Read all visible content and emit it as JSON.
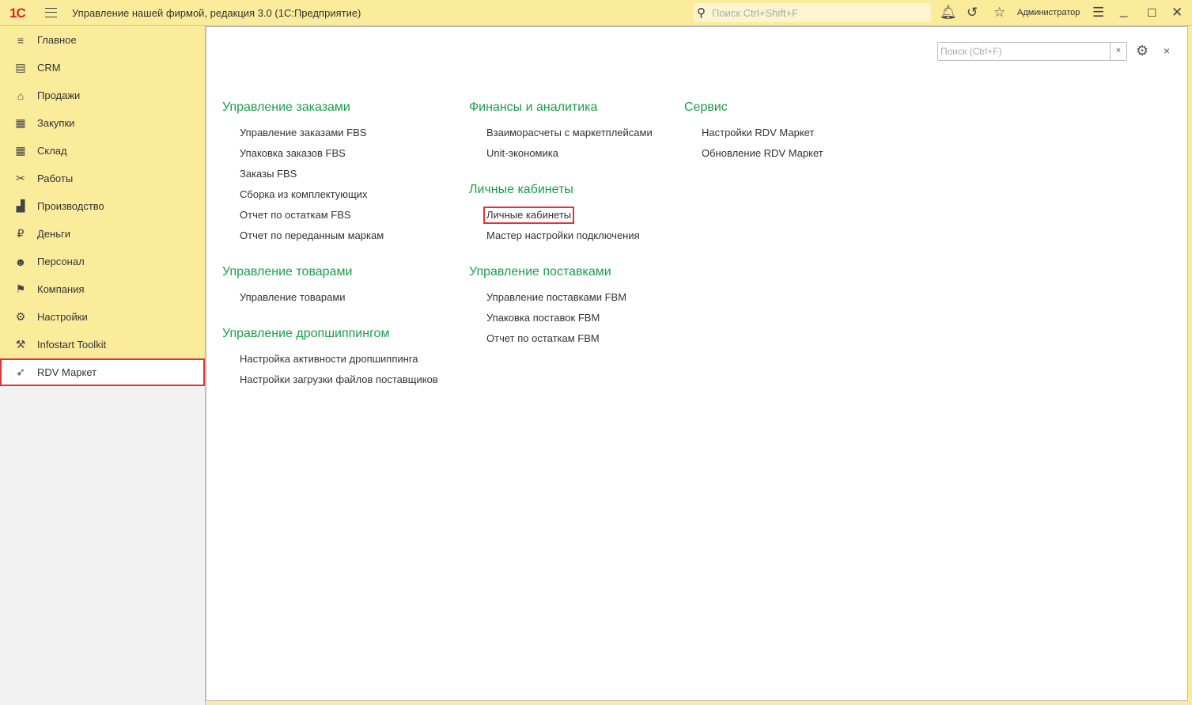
{
  "titlebar": {
    "logo": "1С",
    "title": "Управление нашей фирмой, редакция 3.0  (1С:Предприятие)",
    "search_placeholder": "Поиск Ctrl+Shift+F",
    "user": "Администратор"
  },
  "sidebar": {
    "items": [
      {
        "label": "Главное",
        "icon": "≡"
      },
      {
        "label": "CRM",
        "icon": "▤"
      },
      {
        "label": "Продажи",
        "icon": "⌂"
      },
      {
        "label": "Закупки",
        "icon": "▦"
      },
      {
        "label": "Склад",
        "icon": "▦"
      },
      {
        "label": "Работы",
        "icon": "✂"
      },
      {
        "label": "Производство",
        "icon": "▟"
      },
      {
        "label": "Деньги",
        "icon": "₽"
      },
      {
        "label": "Персонал",
        "icon": "☻"
      },
      {
        "label": "Компания",
        "icon": "⚑"
      },
      {
        "label": "Настройки",
        "icon": "⚙"
      },
      {
        "label": "Infostart Toolkit",
        "icon": "⚒"
      },
      {
        "label": "RDV Маркет",
        "icon": "➶"
      }
    ],
    "selected": "RDV Маркет"
  },
  "panel": {
    "search_placeholder": "Поиск (Ctrl+F)",
    "clear": "×",
    "close": "×"
  },
  "columns": [
    [
      {
        "title": "Управление заказами",
        "links": [
          "Управление заказами FBS",
          "Упаковка заказов FBS",
          "Заказы FBS",
          "Сборка из комплектующих",
          "Отчет по остаткам FBS",
          "Отчет по переданным маркам"
        ]
      },
      {
        "title": "Управление товарами",
        "links": [
          "Управление товарами"
        ]
      },
      {
        "title": "Управление дропшиппингом",
        "links": [
          "Настройка активности дропшиппинга",
          "Настройки загрузки файлов поставщиков"
        ]
      }
    ],
    [
      {
        "title": "Финансы и аналитика",
        "links": [
          "Взаиморасчеты с маркетплейсами",
          "Unit-экономика"
        ]
      },
      {
        "title": "Личные кабинеты",
        "links": [
          "Личные кабинеты",
          "Мастер настройки подключения"
        ]
      },
      {
        "title": "Управление поставками",
        "links": [
          "Управление поставками FBM",
          "Упаковка поставок FBM",
          "Отчет по остаткам FBM"
        ]
      }
    ],
    [
      {
        "title": "Сервис",
        "links": [
          "Настройки RDV Маркет",
          "Обновление RDV Маркет"
        ]
      }
    ]
  ],
  "highlighted_link": "Личные кабинеты"
}
